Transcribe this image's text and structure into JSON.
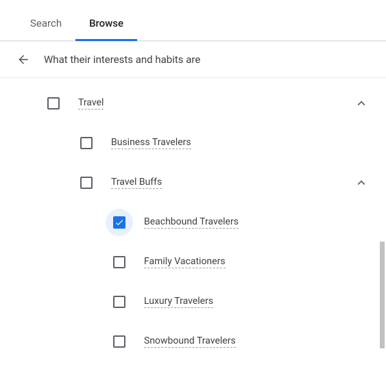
{
  "tabs": {
    "search": "Search",
    "browse": "Browse",
    "active": "browse"
  },
  "header": {
    "title": "What their interests and habits are"
  },
  "tree": {
    "lvl1": {
      "label": "Travel",
      "checked": false,
      "expanded": true
    },
    "lvl2": [
      {
        "label": "Business Travelers",
        "checked": false,
        "expandable": false
      },
      {
        "label": "Travel Buffs",
        "checked": false,
        "expandable": true,
        "expanded": true
      }
    ],
    "lvl3": [
      {
        "label": "Beachbound Travelers",
        "checked": true
      },
      {
        "label": "Family Vacationers",
        "checked": false
      },
      {
        "label": "Luxury Travelers",
        "checked": false
      },
      {
        "label": "Snowbound Travelers",
        "checked": false
      }
    ]
  }
}
